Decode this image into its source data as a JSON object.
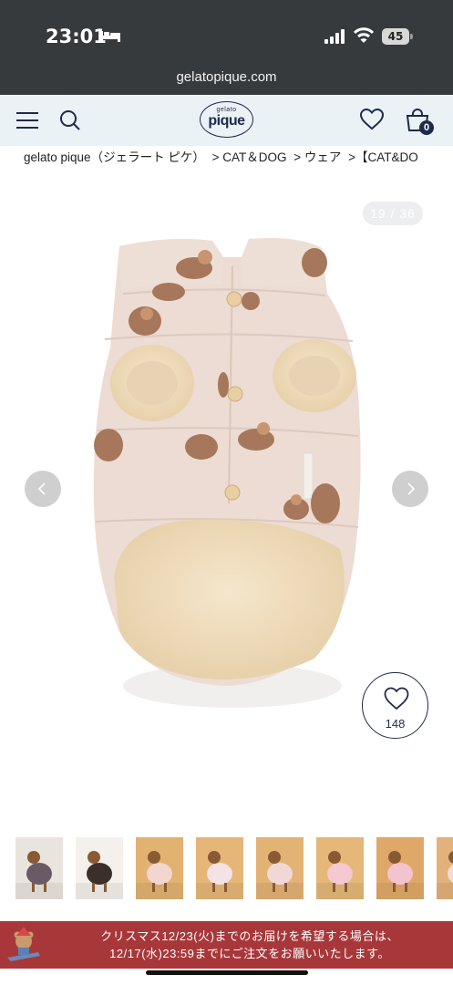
{
  "status_bar": {
    "time": "23:01",
    "battery": "45"
  },
  "browser": {
    "url": "gelatopique.com"
  },
  "header": {
    "logo_small": "gelato",
    "logo_main": "pique",
    "cart_count": "0"
  },
  "breadcrumb": {
    "items": [
      "gelato pique（ジェラート ピケ）",
      "> CAT＆DOG",
      "> ウェア",
      ">【CAT&DO"
    ]
  },
  "gallery": {
    "counter": "19 / 36",
    "likes": "148"
  },
  "thumbnails": [
    {
      "bg": "#e9e4de",
      "fg": "#6a5a66"
    },
    {
      "bg": "#f4f0ec",
      "fg": "#3b2f2a"
    },
    {
      "bg": "#e2b271",
      "fg": "#f2d6cf"
    },
    {
      "bg": "#e6b678",
      "fg": "#f4e2e4"
    },
    {
      "bg": "#e3b275",
      "fg": "#f1d8d6"
    },
    {
      "bg": "#e5b779",
      "fg": "#f5c8d2"
    },
    {
      "bg": "#e0a868",
      "fg": "#f3c4d0"
    },
    {
      "bg": "#e2b27a",
      "fg": "#f2dada"
    }
  ],
  "banner": {
    "line1": "クリスマス12/23(火)までのお届けを希望する場合は、",
    "line2": "12/17(水)23:59までにご注文をお願いいたします。"
  },
  "colors": {
    "navy": "#1e2a4a",
    "header_bg": "#ebf2f6",
    "banner_bg": "#a8373a"
  }
}
